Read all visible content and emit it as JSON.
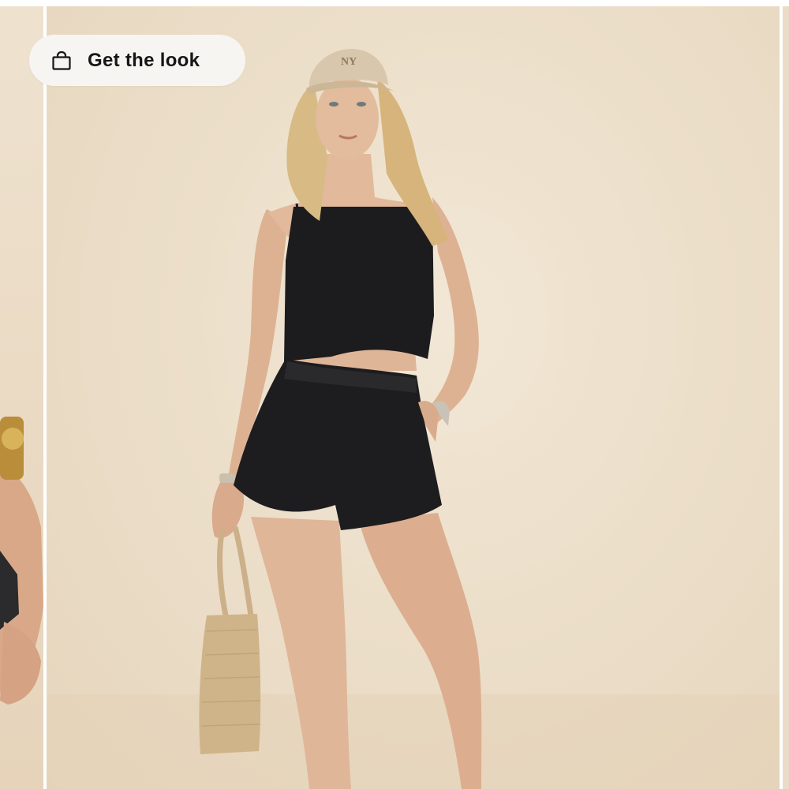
{
  "get_the_look": {
    "label": "Get the look",
    "icon": "shopping-bag-icon"
  },
  "colors": {
    "backdrop": "#ecdfca",
    "outfit": "#1c1c1e",
    "cap": "#d9c7ad",
    "bag": "#cfb48a"
  },
  "hero_image": {
    "cap_logo": "NY"
  }
}
